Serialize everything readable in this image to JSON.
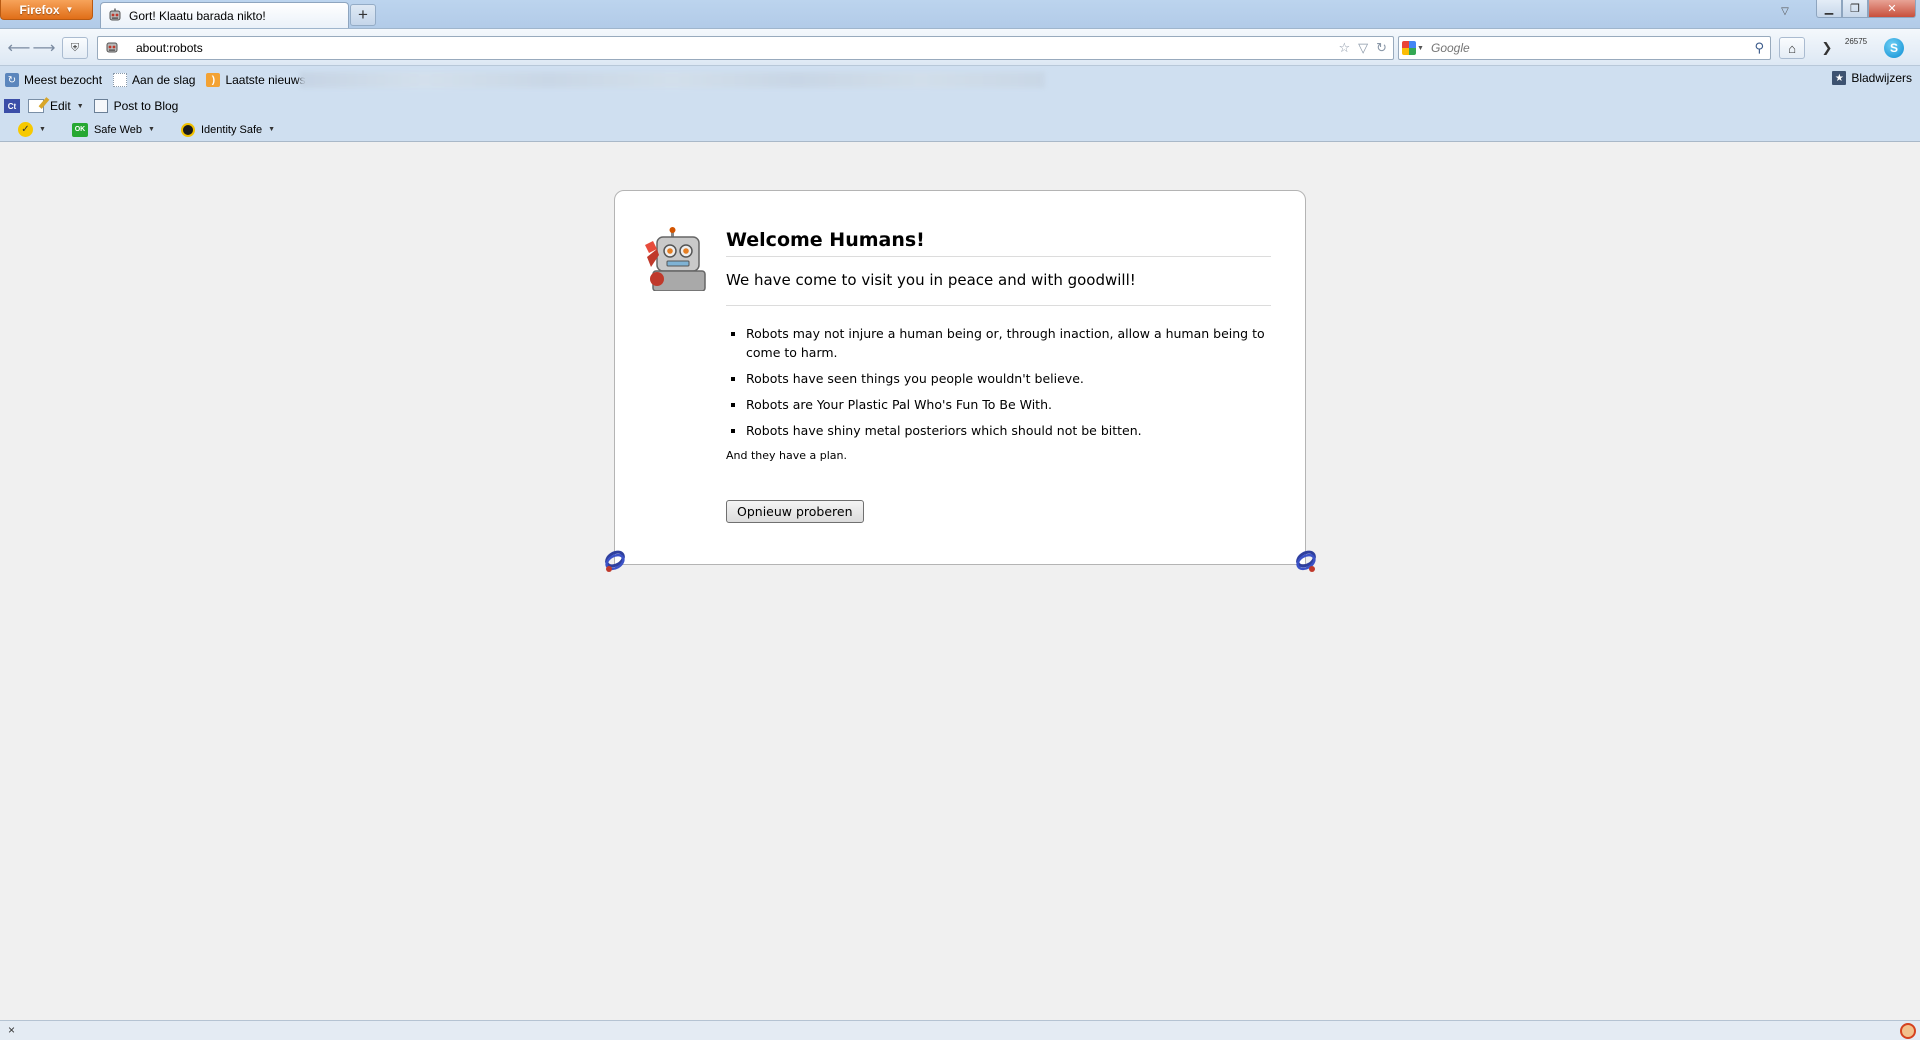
{
  "browser": {
    "app_button": "Firefox",
    "tab_title": "Gort! Klaatu barada nikto!",
    "new_tab": "+",
    "url": "about:robots",
    "search_placeholder": "Google",
    "counter_badge": "26575"
  },
  "bookmarks": {
    "items": [
      {
        "label": "Meest bezocht",
        "icon": "most-visited-icon"
      },
      {
        "label": "Aan de slag",
        "icon": "blank-page-icon"
      },
      {
        "label": "Laatste nieuws",
        "icon": "rss-icon"
      }
    ],
    "right_label": "Bladwijzers"
  },
  "blog_toolbar": {
    "edit_label": "Edit",
    "post_label": "Post to Blog"
  },
  "norton_toolbar": {
    "safe_web_label": "Safe Web",
    "identity_safe_label": "Identity Safe"
  },
  "page": {
    "title": "Welcome Humans!",
    "subtitle": "We have come to visit you in peace and with goodwill!",
    "laws": [
      "Robots may not injure a human being or, through inaction, allow a human being to come to harm.",
      "Robots have seen things you people wouldn't believe.",
      "Robots are Your Plastic Pal Who's Fun To Be With.",
      "Robots have shiny metal posteriors which should not be bitten."
    ],
    "plan": "And they have a plan.",
    "retry_button": "Opnieuw proberen"
  },
  "status": {
    "close": "×"
  },
  "colors": {
    "firefox_orange": "#e06e18",
    "chrome_blue": "#cfdff0",
    "page_bg": "#f0f0f0"
  }
}
